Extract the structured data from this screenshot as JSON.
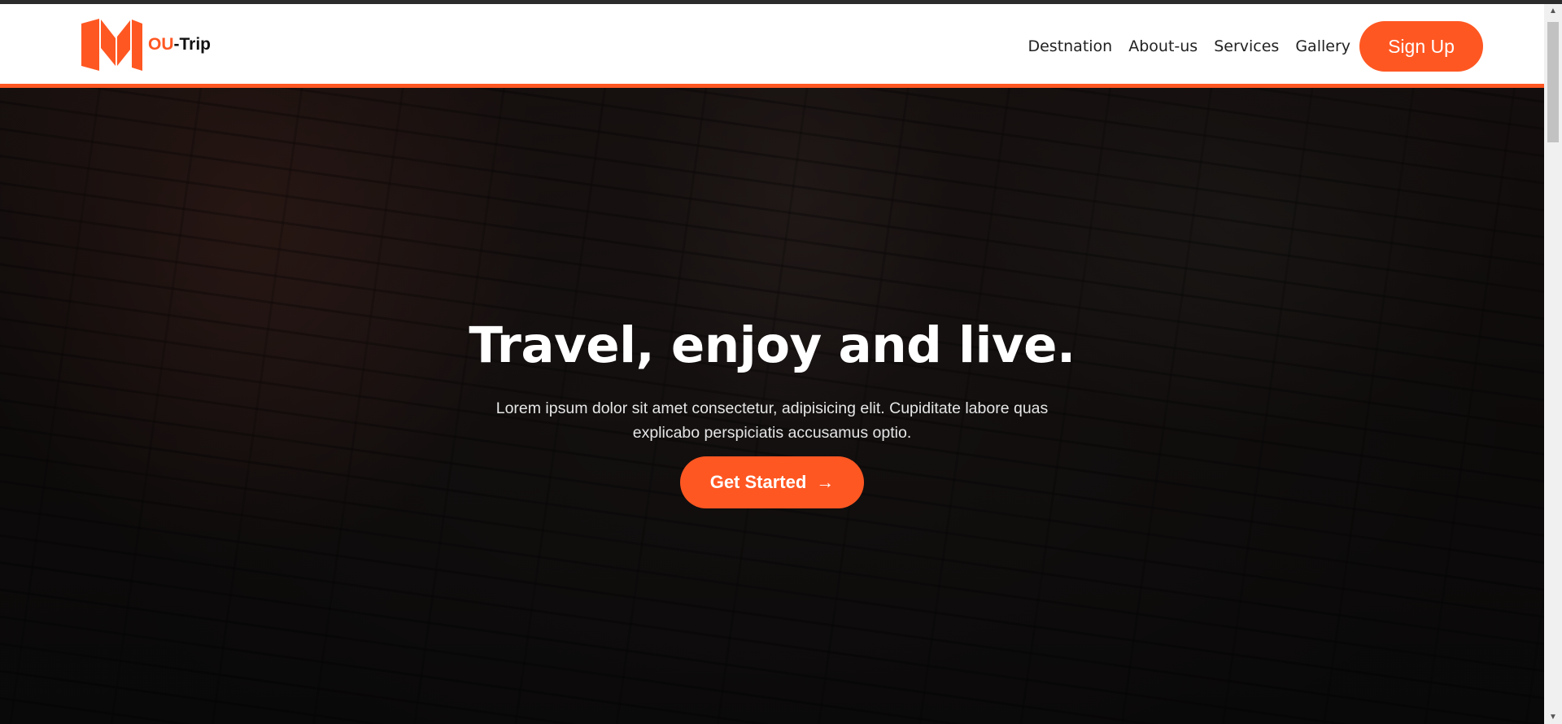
{
  "brand": {
    "name_accent": "OU",
    "name_rest": "-Trip",
    "logo_icon": "folded-map-logo",
    "color": "#ff5722"
  },
  "nav": {
    "links": [
      "Destnation",
      "About-us",
      "Services",
      "Gallery"
    ],
    "signup_label": "Sign Up"
  },
  "hero": {
    "title": "Travel, enjoy and live.",
    "description": "Lorem ipsum dolor sit amet consectetur, adipisicing elit. Cupiditate labore quas explicabo perspiciatis accusamus optio.",
    "cta_label": "Get Started",
    "cta_icon": "arrow-right-icon"
  }
}
